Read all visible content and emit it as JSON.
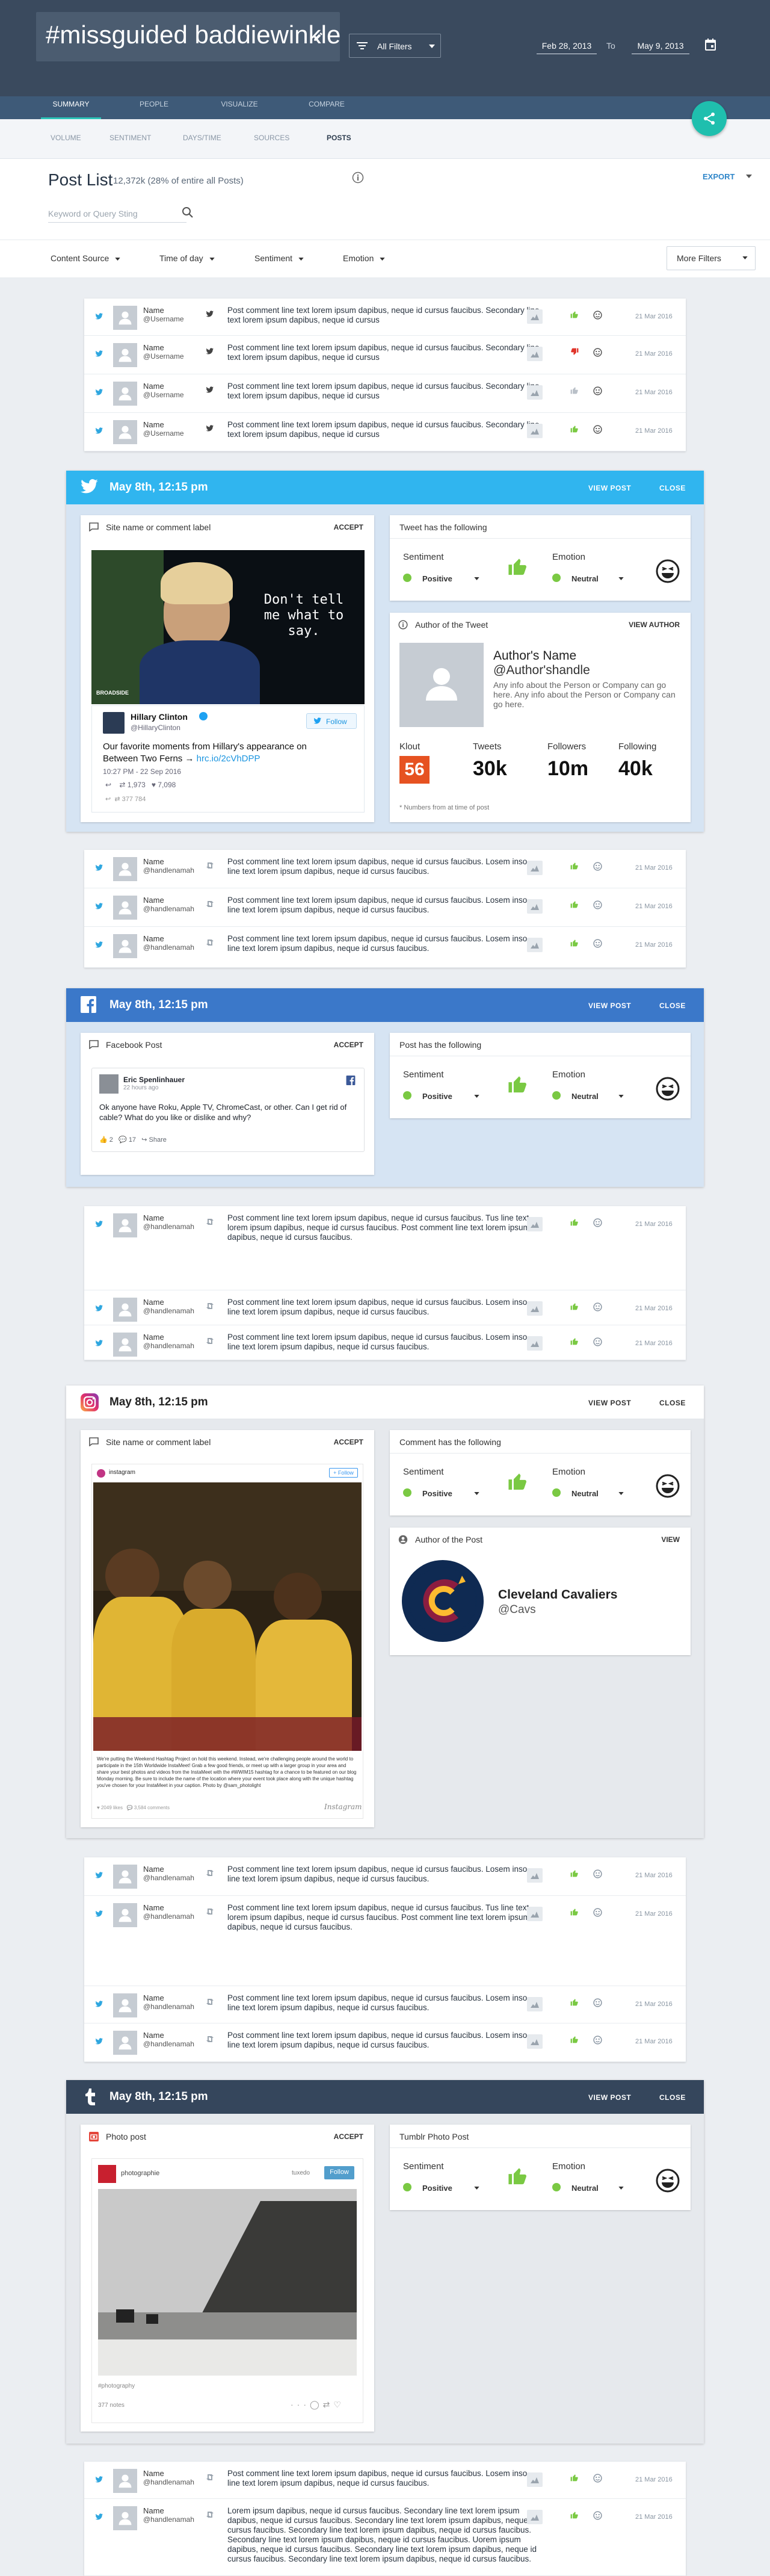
{
  "header": {
    "hashtag": "#missguided baddiewinkle",
    "filters_label": "All Filters",
    "date_from": "Feb 28, 2013",
    "date_to_label": "To",
    "date_to": "May 9, 2013"
  },
  "main_tabs": [
    "Summary",
    "People",
    "Visualize",
    "Compare"
  ],
  "sub_tabs": [
    "Volume",
    "Sentiment",
    "Days/Time",
    "Sources",
    "Posts"
  ],
  "post_list": {
    "title": "Post List",
    "subtitle": "12,372k (28% of entire all Posts)",
    "export_label": "EXPORT",
    "search_placeholder": "Keyword or Query Sting",
    "filters": [
      "Content Source",
      "Time of day",
      "Sentiment",
      "Emotion"
    ],
    "more_filters": "More Filters"
  },
  "rows": {
    "name": "Name",
    "username": "@Username",
    "handle": "@handlenamah",
    "date": "21 Mar 2016",
    "text_short": "Post comment  line text lorem ipsum dapibus, neque id cursus faucibus. Secondary line text lorem ipsum dapibus, neque id cursus",
    "text_losem": "Post comment line text lorem ipsum dapibus, neque id cursus faucibus. Losem inso line text lorem ipsum dapibus, neque id cursus faucibus.",
    "text_tus": "Post comment line text lorem ipsum dapibus, neque id cursus faucibus. Tus line text lorem ipsum dapibus, neque id cursus faucibus. Post comment line text lorem ipsum dapibus, neque id cursus faucibus.",
    "text_long": "Lorem ipsum dapibus, neque id cursus faucibus. Secondary line text lorem ipsum dapibus, neque id cursus faucibus. Secondary line text lorem ipsum dapibus, neque id cursus faucibus. Secondary line text lorem ipsum dapibus, neque id cursus faucibus. Secondary line text lorem ipsum dapibus, neque id cursus faucibus. Uorem ipsum dapibus, neque id cursus faucibus. Secondary line text lorem ipsum dapibus, neque id cursus faucibus. Secondary line text lorem ipsum dapibus, neque id cursus faucibus."
  },
  "detail_common": {
    "datetime": "May 8th, 12:15 pm",
    "view_post": "VIEW POST",
    "close": "CLOSE",
    "accept": "ACCEPT",
    "sentiment_label": "Sentiment",
    "sentiment_value": "Positive",
    "emotion_label": "Emotion",
    "emotion_value": "Neutral"
  },
  "twitter_detail": {
    "left_title": "Site name or comment label",
    "right_title": "Tweet has the following",
    "author_title": "Author of the Tweet",
    "view_author": "VIEW AUTHOR",
    "author_name": "Author's Name",
    "author_handle": "@Author'shandle",
    "author_info": "Any info about the Person or Company can go here. Any info about the Person or Company can go here.",
    "stats": [
      {
        "label": "Klout",
        "value": "56"
      },
      {
        "label": "Tweets",
        "value": "30k"
      },
      {
        "label": "Followers",
        "value": "10m"
      },
      {
        "label": "Following",
        "value": "40k"
      }
    ],
    "footnote": "* Numbers from at time of post",
    "video_caption": "Don't tell me what to say.",
    "video_tag": "BROADSIDE",
    "embed_name": "Hillary Clinton",
    "embed_handle": "@HillaryClinton",
    "follow_label": "Follow",
    "embed_text": "Our favorite moments from Hillary's appearance on Between Two Ferns",
    "embed_link": "hrc.io/2cVhDPP",
    "embed_time": "10:27 PM - 22 Sep 2016",
    "embed_retweets": "1,973",
    "embed_likes": "7,098",
    "embed_extra": "377   784"
  },
  "facebook_detail": {
    "left_title": "Facebook Post",
    "right_title": "Post has the following",
    "fb_name": "Eric Spenlinhauer",
    "fb_time": "22 hours ago",
    "fb_text": "Ok anyone have Roku, Apple TV, ChromeCast, or other. Can I get rid of cable? What do you like or dislike and why?",
    "fb_likes": "2",
    "fb_comments": "17",
    "fb_share": "Share"
  },
  "instagram_detail": {
    "left_title": "Site name or comment label",
    "right_title": "Comment has the following",
    "author_title": "Author of the Post",
    "view": "VIEW",
    "account": "Cleveland Cavaliers",
    "handle": "@Cavs",
    "ig_user": "instagram",
    "ig_follow": "+ Follow",
    "ig_caption": "We're putting the Weekend Hashtag Project on hold this weekend. Instead, we're challenging people around the world to participate in the 15th Worldwide InstaMeet! Grab a few good friends, or meet up with a larger group in your area and share your best photos and videos from the InstaMeet with the #WWIM15 hashtag for a chance to be featured on our blog Monday morning. Be sure to include the name of the location where your event took place along with the unique hashtag you've chosen for your InstaMeet in your caption. Photo by @sam_photolight",
    "ig_likes": "♥ 2049 likes",
    "ig_comments": "3,584 comments",
    "ig_brand": "Instagram"
  },
  "tumblr_detail": {
    "left_title": "Photo post",
    "right_title": "Tumblr Photo Post",
    "tb_user": "photographie",
    "tb_user2": "tuxedo",
    "tb_follow": "Follow",
    "tb_tags": "#photography",
    "tb_notes": "377 notes"
  },
  "colors": {
    "header_bg": "#3a4a5e",
    "twitter": "#30b5ef",
    "facebook": "#3b78c9",
    "tumblr": "#35465c",
    "accent": "#1fbfae",
    "positive": "#7ac943",
    "klout": "#e65221"
  }
}
